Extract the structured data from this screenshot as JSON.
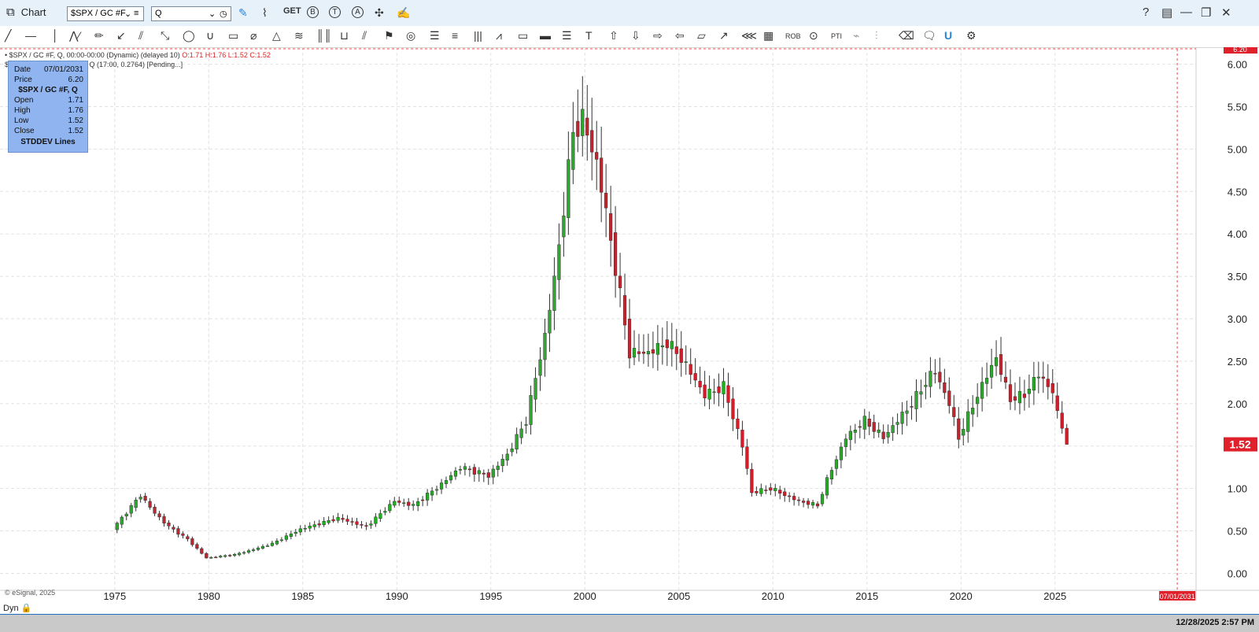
{
  "window": {
    "title": "Chart",
    "symbol": "$SPX / GC #F",
    "search_value": "Q"
  },
  "toolbar": {
    "icons": [
      "pencil-icon",
      "oscillator-icon",
      "get-icon",
      "b-icon",
      "t-icon",
      "a-icon",
      "tools-icon",
      "edit-icon"
    ],
    "get_label": "GET",
    "b_label": "B",
    "t_label": "T",
    "a_label": "A"
  },
  "window_controls": {
    "help": "?",
    "layout": "layout-icon",
    "restore": "restore-icon",
    "close": "close-icon"
  },
  "info": {
    "line1": "• $SPX / GC #F, Q, 00:00-00:00 (Dynamic) (delayed 10)",
    "line1_ohlc": "O:1.71 H:1.76 L:1.52 C:1.52",
    "line2": "$",
    "line2b": "F, Q (17:00, 0.2764) [Pending...]"
  },
  "tooltip": {
    "date_label": "Date",
    "date_value": "07/01/2031",
    "price_label": "Price",
    "price_value": "6.20",
    "symbol": "$SPX / GC #F, Q",
    "open_label": "Open",
    "open_value": "1.71",
    "high_label": "High",
    "high_value": "1.76",
    "low_label": "Low",
    "low_value": "1.52",
    "close_label": "Close",
    "close_value": "1.52",
    "study": "STDDEV Lines"
  },
  "footer": {
    "copyright": "© eSignal, 2025",
    "dyn": "Dyn",
    "clock": "12/28/2025 2:57 PM"
  },
  "colors": {
    "up": "#22b022",
    "down": "#d01e2a",
    "wick": "#333333",
    "grid": "#e2e2e2",
    "accent": "#1d70c2",
    "price_box": "#e0202a"
  },
  "chart_data": {
    "type": "candlestick",
    "x_axis": {
      "ticks": [
        "1975",
        "1980",
        "1985",
        "1990",
        "1995",
        "2000",
        "2005",
        "2010",
        "2015",
        "2020",
        "2025"
      ],
      "range": [
        1968.9,
        2032.5
      ]
    },
    "y_axis": {
      "ticks": [
        "0.00",
        "0.50",
        "1.00",
        "1.50",
        "2.00",
        "2.50",
        "3.00",
        "3.50",
        "4.00",
        "4.50",
        "5.00",
        "5.50",
        "6.00"
      ],
      "range": [
        -0.2,
        6.2
      ]
    },
    "grid": true,
    "last_price_label": "1.52",
    "crosshair_price_label": "6.20",
    "crosshair_date_label": "07/01/2031",
    "anchors": [
      [
        1975.0,
        0.52
      ],
      [
        1976.5,
        0.92
      ],
      [
        1977.2,
        0.72
      ],
      [
        1978.0,
        0.55
      ],
      [
        1979.0,
        0.4
      ],
      [
        1980.0,
        0.18
      ],
      [
        1981.5,
        0.22
      ],
      [
        1982.5,
        0.28
      ],
      [
        1983.5,
        0.35
      ],
      [
        1985.0,
        0.52
      ],
      [
        1987.0,
        0.65
      ],
      [
        1988.5,
        0.55
      ],
      [
        1990.0,
        0.85
      ],
      [
        1991.0,
        0.8
      ],
      [
        1992.5,
        1.05
      ],
      [
        1993.5,
        1.25
      ],
      [
        1995.0,
        1.15
      ],
      [
        1996.0,
        1.4
      ],
      [
        1997.0,
        1.8
      ],
      [
        1998.0,
        2.8
      ],
      [
        1998.6,
        3.6
      ],
      [
        1999.5,
        5.2
      ],
      [
        2000.0,
        5.35
      ],
      [
        2000.8,
        4.8
      ],
      [
        2001.6,
        3.8
      ],
      [
        2002.5,
        2.6
      ],
      [
        2003.5,
        2.6
      ],
      [
        2004.5,
        2.72
      ],
      [
        2005.2,
        2.55
      ],
      [
        2006.5,
        2.1
      ],
      [
        2007.5,
        2.2
      ],
      [
        2008.5,
        1.5
      ],
      [
        2009.0,
        0.95
      ],
      [
        2010.0,
        1.0
      ],
      [
        2011.5,
        0.85
      ],
      [
        2012.5,
        0.8
      ],
      [
        2013.0,
        1.1
      ],
      [
        2014.0,
        1.6
      ],
      [
        2015.0,
        1.8
      ],
      [
        2016.0,
        1.6
      ],
      [
        2017.5,
        2.0
      ],
      [
        2018.7,
        2.4
      ],
      [
        2019.5,
        2.0
      ],
      [
        2020.0,
        1.6
      ],
      [
        2021.0,
        2.1
      ],
      [
        2022.0,
        2.55
      ],
      [
        2022.7,
        2.05
      ],
      [
        2023.5,
        2.1
      ],
      [
        2024.2,
        2.35
      ],
      [
        2025.0,
        2.15
      ],
      [
        2025.3,
        1.8
      ],
      [
        2025.6,
        1.71
      ],
      [
        2025.8,
        1.52
      ]
    ],
    "candle_step_years": 0.25,
    "last_candle": {
      "open": 1.71,
      "high": 1.76,
      "low": 1.52,
      "close": 1.52
    }
  }
}
